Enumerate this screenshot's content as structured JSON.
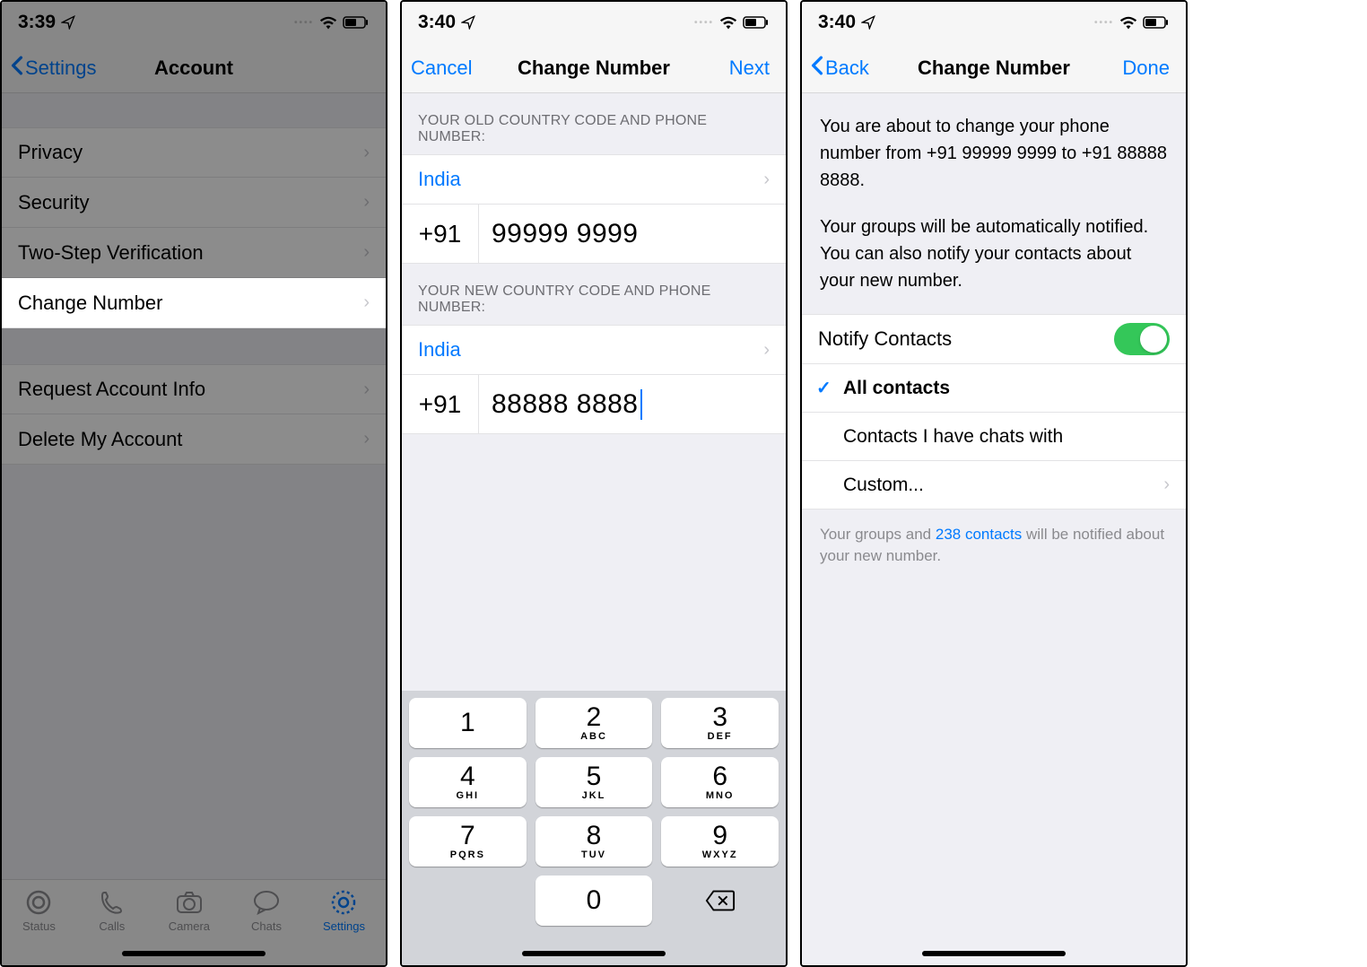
{
  "screen1": {
    "status": {
      "time": "3:39"
    },
    "nav": {
      "back": "Settings",
      "title": "Account"
    },
    "rows": {
      "privacy": "Privacy",
      "security": "Security",
      "twostep": "Two-Step Verification",
      "changenum": "Change Number",
      "reqinfo": "Request Account Info",
      "delete": "Delete My Account"
    },
    "tabs": {
      "status": "Status",
      "calls": "Calls",
      "camera": "Camera",
      "chats": "Chats",
      "settings": "Settings"
    }
  },
  "screen2": {
    "status": {
      "time": "3:40"
    },
    "nav": {
      "cancel": "Cancel",
      "title": "Change Number",
      "next": "Next"
    },
    "headers": {
      "old": "YOUR OLD COUNTRY CODE AND PHONE NUMBER:",
      "new": "YOUR NEW COUNTRY CODE AND PHONE NUMBER:"
    },
    "old": {
      "country": "India",
      "code": "+91",
      "number": "99999 9999"
    },
    "new": {
      "country": "India",
      "code": "+91",
      "number": "88888 8888"
    },
    "keypad": {
      "k1": {
        "n": "1",
        "l": ""
      },
      "k2": {
        "n": "2",
        "l": "ABC"
      },
      "k3": {
        "n": "3",
        "l": "DEF"
      },
      "k4": {
        "n": "4",
        "l": "GHI"
      },
      "k5": {
        "n": "5",
        "l": "JKL"
      },
      "k6": {
        "n": "6",
        "l": "MNO"
      },
      "k7": {
        "n": "7",
        "l": "PQRS"
      },
      "k8": {
        "n": "8",
        "l": "TUV"
      },
      "k9": {
        "n": "9",
        "l": "WXYZ"
      },
      "k0": {
        "n": "0",
        "l": ""
      }
    }
  },
  "screen3": {
    "status": {
      "time": "3:40"
    },
    "nav": {
      "back": "Back",
      "title": "Change Number",
      "done": "Done"
    },
    "info": {
      "p1": "You are about to change your phone number from +91 99999 9999 to +91 88888 8888.",
      "p2": "Your groups will be automatically notified. You can also notify your contacts about your new number."
    },
    "notify": {
      "label": "Notify Contacts",
      "all": "All contacts",
      "chats": "Contacts I have chats with",
      "custom": "Custom..."
    },
    "footer": {
      "pre": "Your groups and ",
      "link": "238 contacts",
      "post": " will be notified about your new number."
    }
  }
}
